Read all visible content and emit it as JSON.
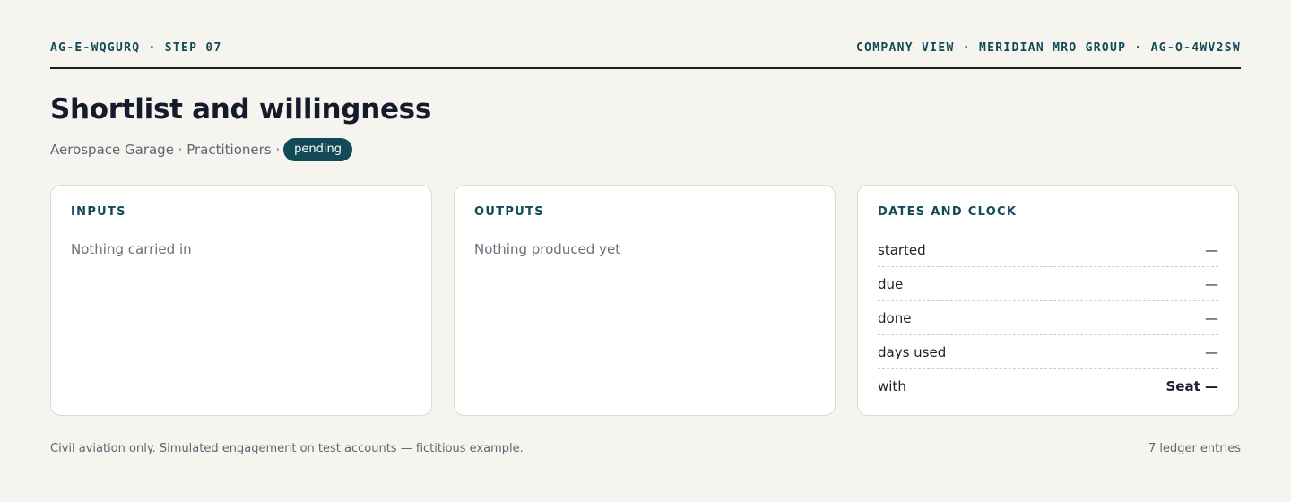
{
  "header": {
    "left": "AG-E-WQGURQ · STEP 07",
    "right": "COMPANY VIEW · MERIDIAN MRO GROUP · AG-O-4WV2SW"
  },
  "page": {
    "title": "Shortlist and willingness",
    "subtitle": "Aerospace Garage · Practitioners ·",
    "status": "pending"
  },
  "cards": {
    "inputs": {
      "heading": "INPUTS",
      "empty": "Nothing carried in"
    },
    "outputs": {
      "heading": "OUTPUTS",
      "empty": "Nothing produced yet"
    },
    "dates": {
      "heading": "DATES AND CLOCK",
      "rows": [
        {
          "label": "started",
          "value": "—"
        },
        {
          "label": "due",
          "value": "—"
        },
        {
          "label": "done",
          "value": "—"
        },
        {
          "label": "days used",
          "value": "—"
        },
        {
          "label": "with",
          "value": "Seat —"
        }
      ]
    }
  },
  "footer": {
    "note": "Civil aviation only. Simulated engagement on test accounts — fictitious example.",
    "count": "7 ledger entries"
  },
  "colors": {
    "background": "#f5f4ef",
    "accent": "#124a58",
    "text": "#1a1f2b"
  }
}
